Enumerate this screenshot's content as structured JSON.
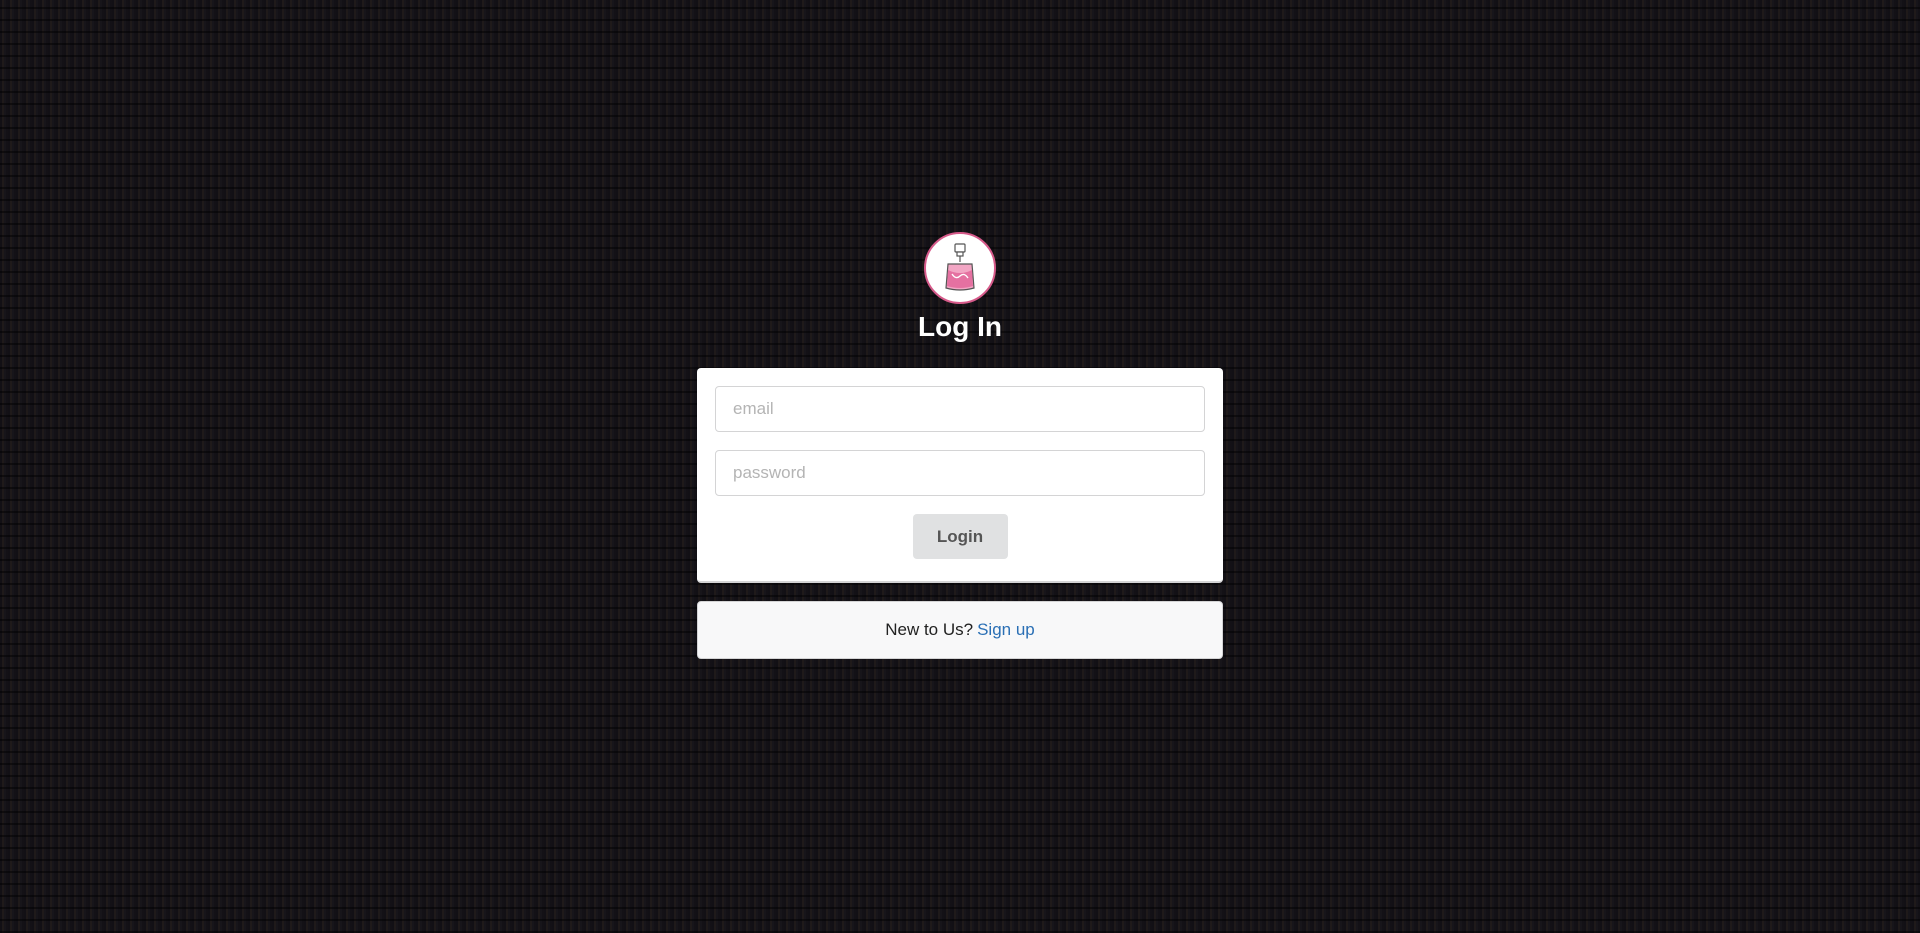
{
  "logo": {
    "icon": "perfume-bottle-icon",
    "accent": "#d65a8a"
  },
  "title": "Log In",
  "form": {
    "email_placeholder": "email",
    "email_value": "",
    "password_placeholder": "password",
    "password_value": "",
    "login_label": "Login"
  },
  "signup": {
    "prompt": "New to Us?",
    "link_label": "Sign up",
    "link_color": "#2a6fb5"
  }
}
